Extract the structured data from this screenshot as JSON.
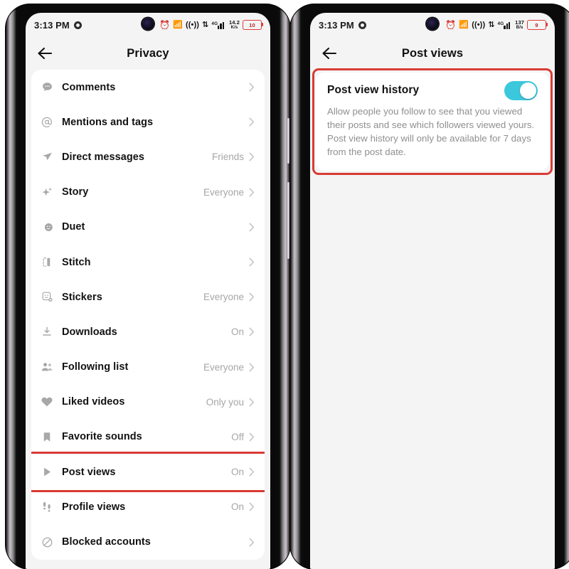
{
  "phones": [
    {
      "id": "left",
      "status_bar": {
        "clock": "3:13 PM",
        "notification_icon": "camera-dot-icon",
        "alarm_icon": "alarm-clock-icon",
        "bluetooth_icon": "bluetooth-icon",
        "hotspot_icon": "wireless-signal-icon",
        "data_transfer_icon": "data-up-down-icon",
        "network_type": "4G",
        "net_speed_value": "14.2",
        "net_speed_unit": "K/s",
        "battery_level": "10"
      },
      "app_bar": {
        "back_icon": "back-arrow-icon",
        "title": "Privacy"
      },
      "list_items": [
        {
          "icon": "comment-bubble-icon",
          "label": "Comments",
          "value": ""
        },
        {
          "icon": "at-mention-icon",
          "label": "Mentions and tags",
          "value": ""
        },
        {
          "icon": "paper-plane-icon",
          "label": "Direct messages",
          "value": "Friends"
        },
        {
          "icon": "sparkle-icon",
          "label": "Story",
          "value": "Everyone"
        },
        {
          "icon": "duet-icon",
          "label": "Duet",
          "value": ""
        },
        {
          "icon": "stitch-icon",
          "label": "Stitch",
          "value": ""
        },
        {
          "icon": "sticker-icon",
          "label": "Stickers",
          "value": "Everyone"
        },
        {
          "icon": "download-icon",
          "label": "Downloads",
          "value": "On"
        },
        {
          "icon": "people-group-icon",
          "label": "Following list",
          "value": "Everyone"
        },
        {
          "icon": "heart-icon",
          "label": "Liked videos",
          "value": "Only you"
        },
        {
          "icon": "bookmark-icon",
          "label": "Favorite sounds",
          "value": "Off"
        },
        {
          "icon": "play-triangle-icon",
          "label": "Post views",
          "value": "On",
          "highlighted": true
        },
        {
          "icon": "footprints-icon",
          "label": "Profile views",
          "value": "On"
        },
        {
          "icon": "blocked-circle-icon",
          "label": "Blocked accounts",
          "value": ""
        }
      ]
    },
    {
      "id": "right",
      "status_bar": {
        "clock": "3:13 PM",
        "notification_icon": "camera-dot-icon",
        "alarm_icon": "alarm-clock-icon",
        "bluetooth_icon": "bluetooth-icon",
        "hotspot_icon": "wireless-signal-icon",
        "data_transfer_icon": "data-up-down-icon",
        "network_type": "4G",
        "net_speed_value": "137",
        "net_speed_unit": "B/s",
        "battery_level": "9"
      },
      "app_bar": {
        "back_icon": "back-arrow-icon",
        "title": "Post views"
      },
      "panel": {
        "title": "Post view history",
        "description": "Allow people you follow to see that you viewed their posts and see which followers viewed yours. Post view history will only be available for 7 days from the post date.",
        "toggle_state": "on",
        "highlighted": true
      }
    }
  ],
  "colors": {
    "highlight_red": "#d93b35",
    "toggle_on": "#3cc8dc",
    "screen_bg": "#f4f4f4",
    "card_bg": "#ffffff",
    "label_text": "#121212",
    "value_text": "#a6a6a6",
    "battery_red": "#e03b3b"
  }
}
